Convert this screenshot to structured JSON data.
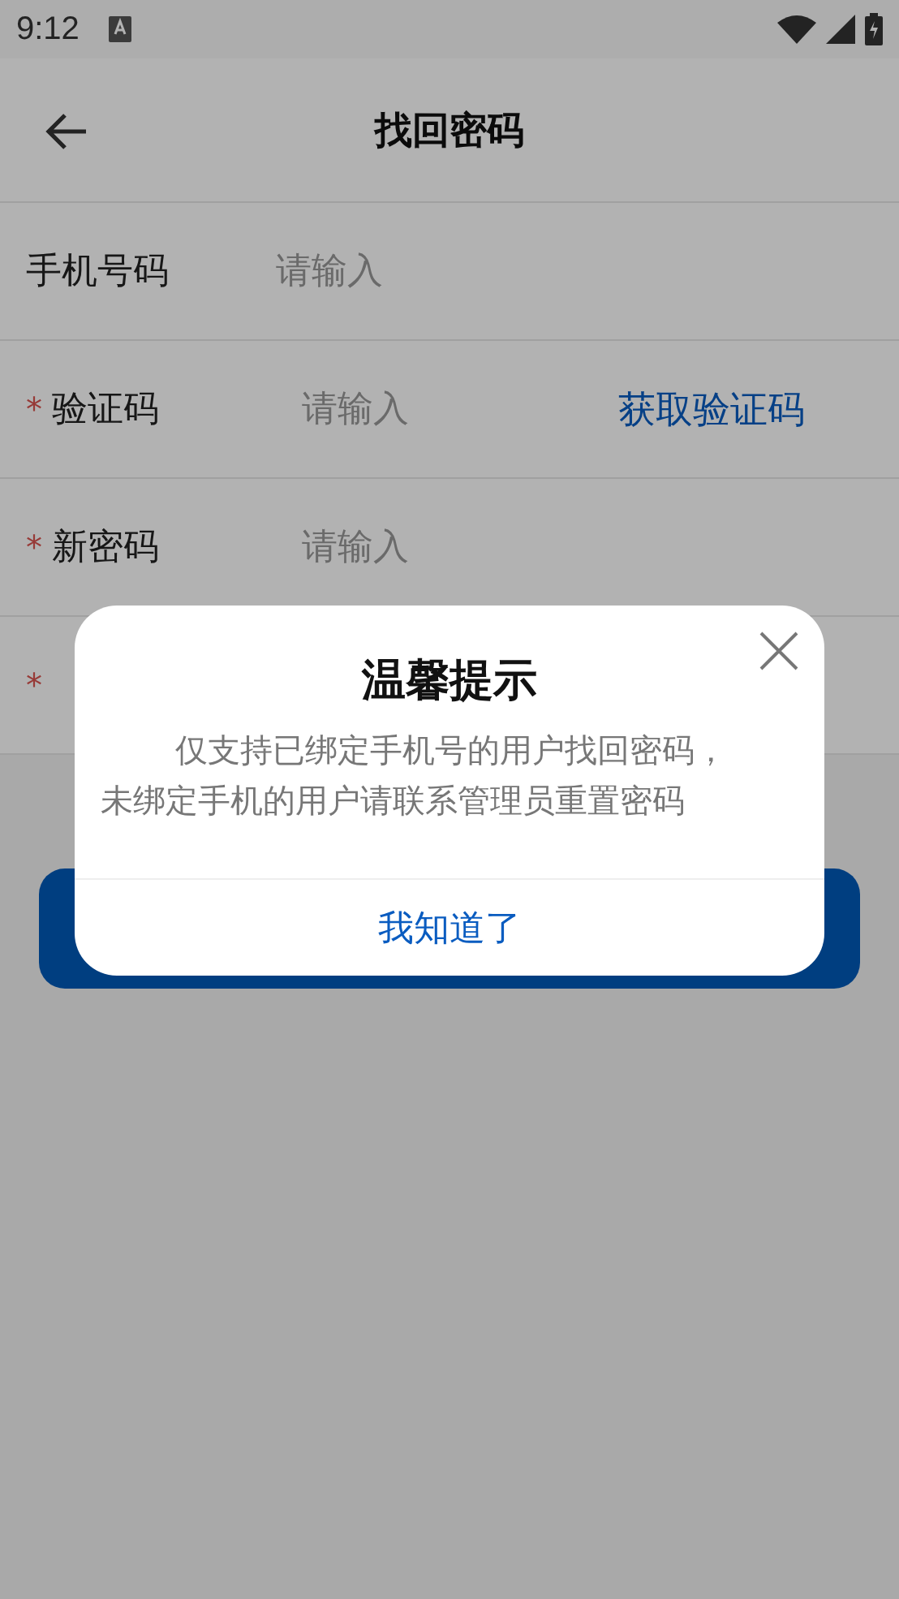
{
  "status_bar": {
    "time": "9:12"
  },
  "header": {
    "title": "找回密码"
  },
  "form": {
    "rows": [
      {
        "label": "手机号码",
        "required": false,
        "placeholder": "请输入"
      },
      {
        "label": "验证码",
        "required": true,
        "placeholder": "请输入",
        "action": "获取验证码"
      },
      {
        "label": "新密码",
        "required": true,
        "placeholder": "请输入"
      },
      {
        "required": true
      }
    ],
    "required_mark": "*"
  },
  "dialog": {
    "title": "温馨提示",
    "message_lines": [
      "仅支持已绑定手机号的用户找回密码，",
      "未绑定手机的用户请联系管理员重置密码"
    ],
    "button": "我知道了"
  }
}
